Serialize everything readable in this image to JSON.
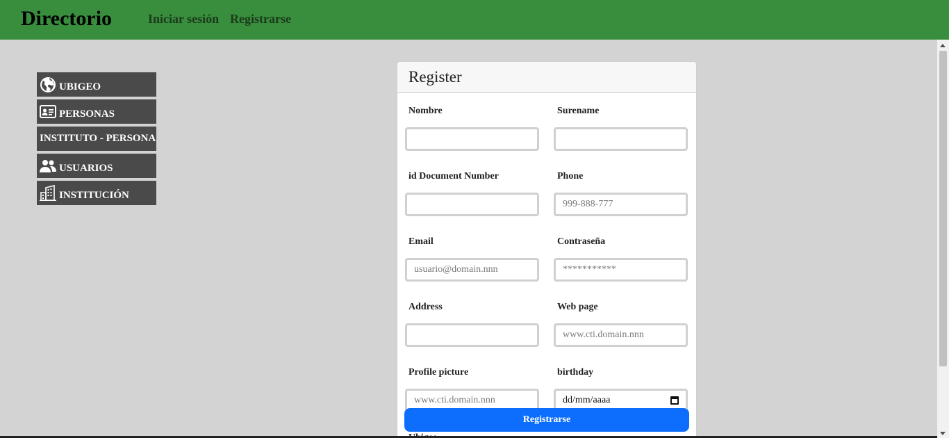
{
  "header": {
    "brand": "Directorio",
    "nav": {
      "login": "Iniciar sesión",
      "register": "Registrarse"
    }
  },
  "sidebar": {
    "items": [
      {
        "label": "UBIGEO",
        "icon": "globe-icon"
      },
      {
        "label": "PERSONAS",
        "icon": "id-card-icon"
      },
      {
        "label": "INSTITUTO - PERSONA",
        "icon": ""
      },
      {
        "label": "USUARIOS",
        "icon": "users-icon"
      },
      {
        "label": "INSTITUCIÓN",
        "icon": "building-icon"
      }
    ]
  },
  "form": {
    "title": "Register",
    "fields": {
      "nombre": {
        "label": "Nombre",
        "placeholder": ""
      },
      "surename": {
        "label": "Surename",
        "placeholder": ""
      },
      "document": {
        "label": "id Document Number",
        "placeholder": ""
      },
      "phone": {
        "label": "Phone",
        "placeholder": "999-888-777"
      },
      "email": {
        "label": "Email",
        "placeholder": "usuario@domain.nnn"
      },
      "password": {
        "label": "Contraseña",
        "placeholder": "***********"
      },
      "address": {
        "label": "Address",
        "placeholder": ""
      },
      "webpage": {
        "label": "Web page",
        "placeholder": "www.cti.domain.nnn"
      },
      "picture": {
        "label": "Profile picture",
        "placeholder": "www.cti.domain.nnn"
      },
      "birthday": {
        "label": "birthday",
        "value": "dd/mm/aaaa"
      },
      "ubigeo": {
        "label": "Ubigeo"
      }
    },
    "submit_label": "Registrarse"
  }
}
